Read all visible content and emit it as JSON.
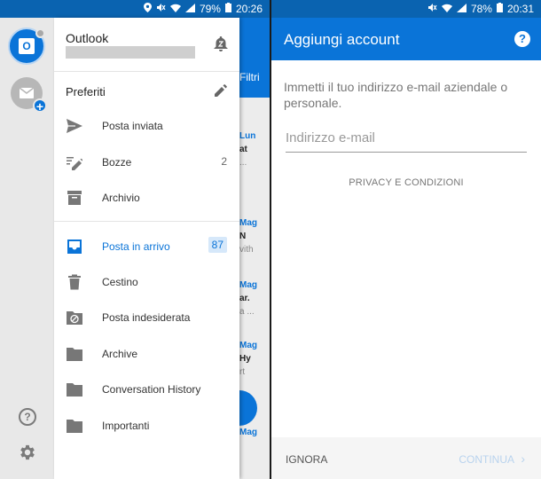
{
  "left_status": {
    "battery": "79%",
    "time": "20:26"
  },
  "right_status": {
    "battery": "78%",
    "time": "20:31"
  },
  "background_list": {
    "filter_label": "Filtri",
    "rows": [
      {
        "date": "Lun",
        "subject": "at",
        "preview": "..."
      },
      {
        "date": "Mag",
        "subject": "N",
        "preview": "vith"
      },
      {
        "date": "Mag",
        "subject": "ar.",
        "preview": "a ..."
      },
      {
        "date": "Mag",
        "subject": "Hy",
        "preview": "rt"
      },
      {
        "date": "Mag",
        "subject": "",
        "preview": ""
      }
    ]
  },
  "drawer": {
    "account_name": "Outlook",
    "favorites_label": "Preferiti",
    "favorites": [
      {
        "label": "Posta inviata",
        "count": ""
      },
      {
        "label": "Bozze",
        "count": "2"
      },
      {
        "label": "Archivio",
        "count": ""
      }
    ],
    "folders": [
      {
        "label": "Posta in arrivo",
        "count": "87"
      },
      {
        "label": "Cestino",
        "count": ""
      },
      {
        "label": "Posta indesiderata",
        "count": ""
      },
      {
        "label": "Archive",
        "count": ""
      },
      {
        "label": "Conversation History",
        "count": ""
      },
      {
        "label": "Importanti",
        "count": ""
      }
    ]
  },
  "add_account": {
    "title": "Aggiungi account",
    "instructions": "Immetti il tuo indirizzo e-mail aziendale o personale.",
    "email_placeholder": "Indirizzo e-mail",
    "privacy_link": "PRIVACY E CONDIZIONI",
    "skip_label": "IGNORA",
    "continue_label": "CONTINUA"
  },
  "colors": {
    "accent": "#0a74d8",
    "statusbar": "#0a63b0",
    "disabled": "#b9d3ee"
  }
}
